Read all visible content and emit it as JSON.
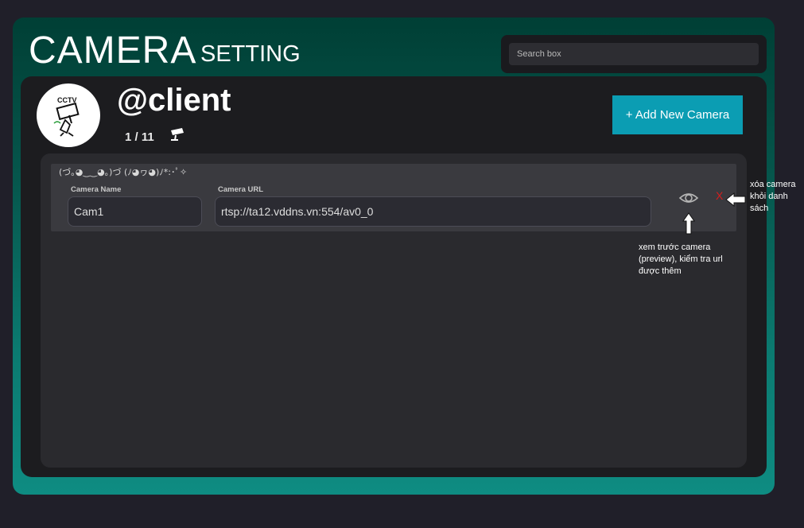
{
  "header": {
    "title": "CAMERA",
    "subtitle": "SETTING"
  },
  "search": {
    "placeholder": "Search box"
  },
  "profile": {
    "avatar_text": "CCTV",
    "name": "@client",
    "counter": "1 / 11",
    "camera_icon": "security-camera-icon"
  },
  "actions": {
    "add_label": "+ Add New Camera"
  },
  "cameras": [
    {
      "header": "(づ｡◕‿‿◕｡)づ (ﾉ◕ヮ◕)ﾉ*:･ﾟ✧",
      "name_label": "Camera Name",
      "name_value": "Cam1",
      "url_label": "Camera URL",
      "url_value": "rtsp://ta12.vddns.vn:554/av0_0",
      "preview_icon": "eye-icon",
      "delete_label": "X"
    }
  ],
  "annotations": {
    "delete_note": [
      "xóa camera",
      "khỏi danh",
      "sách"
    ],
    "preview_note": [
      "xem trước camera",
      "(preview), kiểm tra url",
      "được thêm"
    ]
  },
  "colors": {
    "background": "#201f29",
    "gradient_top": "#003f35",
    "gradient_bottom": "#0e8c82",
    "panel": "#1c1c1f",
    "accent_button": "#0b9db3",
    "delete": "#d41e1e"
  }
}
